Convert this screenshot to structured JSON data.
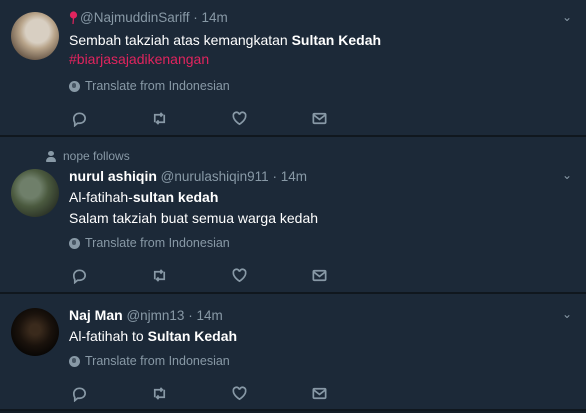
{
  "tweets": [
    {
      "handle": "@NajmuddinSariff",
      "time": "· 14m",
      "text_plain": "Sembah takziah atas kemangkatan ",
      "text_bold": "Sultan Kedah",
      "hashtag": "#biarjasajadikenangan",
      "translate": "Translate from Indonesian"
    },
    {
      "social_context": "nope follows",
      "name": "nurul ashiqin",
      "handle": "@nurulashiqin911",
      "time": "· 14m",
      "line1_plain": "Al-fatihah-",
      "line1_bold": "sultan kedah",
      "line2": "Salam takziah buat semua warga kedah",
      "translate": "Translate from Indonesian"
    },
    {
      "name": "Naj Man",
      "handle": "@njmn13",
      "time": "· 14m",
      "text_plain": "Al-fatihah to ",
      "text_bold": "Sultan Kedah",
      "translate": "Translate from Indonesian"
    }
  ],
  "icons": {
    "reply": "reply-icon",
    "retweet": "retweet-icon",
    "like": "heart-icon",
    "dm": "envelope-icon",
    "menu": "chevron-down-icon",
    "translate": "globe-icon",
    "pin": "location-pin-icon",
    "follow": "person-icon"
  },
  "colors": {
    "background": "#1c2938",
    "separator": "#10171e",
    "muted": "#8899a6",
    "hashtag": "#e0245e"
  }
}
